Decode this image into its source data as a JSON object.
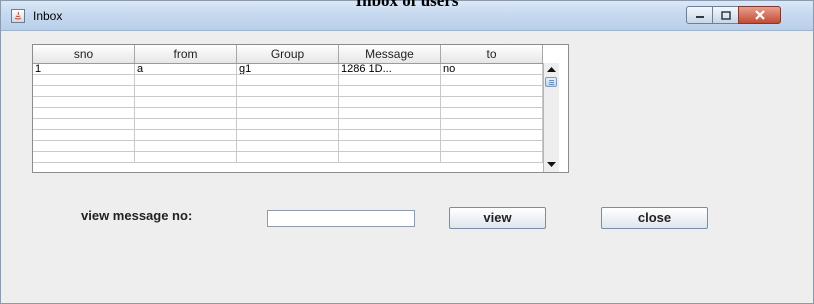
{
  "caption": "Inbox of users",
  "window": {
    "title": "Inbox",
    "controls": {
      "minimize": "minimize",
      "maximize": "maximize",
      "close": "close"
    }
  },
  "table": {
    "columns": [
      "sno",
      "from",
      "Group",
      "Message",
      "to"
    ],
    "rows": [
      [
        "1",
        "a",
        "g1",
        "1286 1D...",
        "no"
      ],
      [
        "",
        "",
        "",
        "",
        ""
      ],
      [
        "",
        "",
        "",
        "",
        ""
      ],
      [
        "",
        "",
        "",
        "",
        ""
      ],
      [
        "",
        "",
        "",
        "",
        ""
      ],
      [
        "",
        "",
        "",
        "",
        ""
      ],
      [
        "",
        "",
        "",
        "",
        ""
      ],
      [
        "",
        "",
        "",
        "",
        ""
      ],
      [
        "",
        "",
        "",
        "",
        ""
      ]
    ]
  },
  "form": {
    "label": "view message no:",
    "input_value": "",
    "view_label": "view",
    "close_label": "close"
  }
}
